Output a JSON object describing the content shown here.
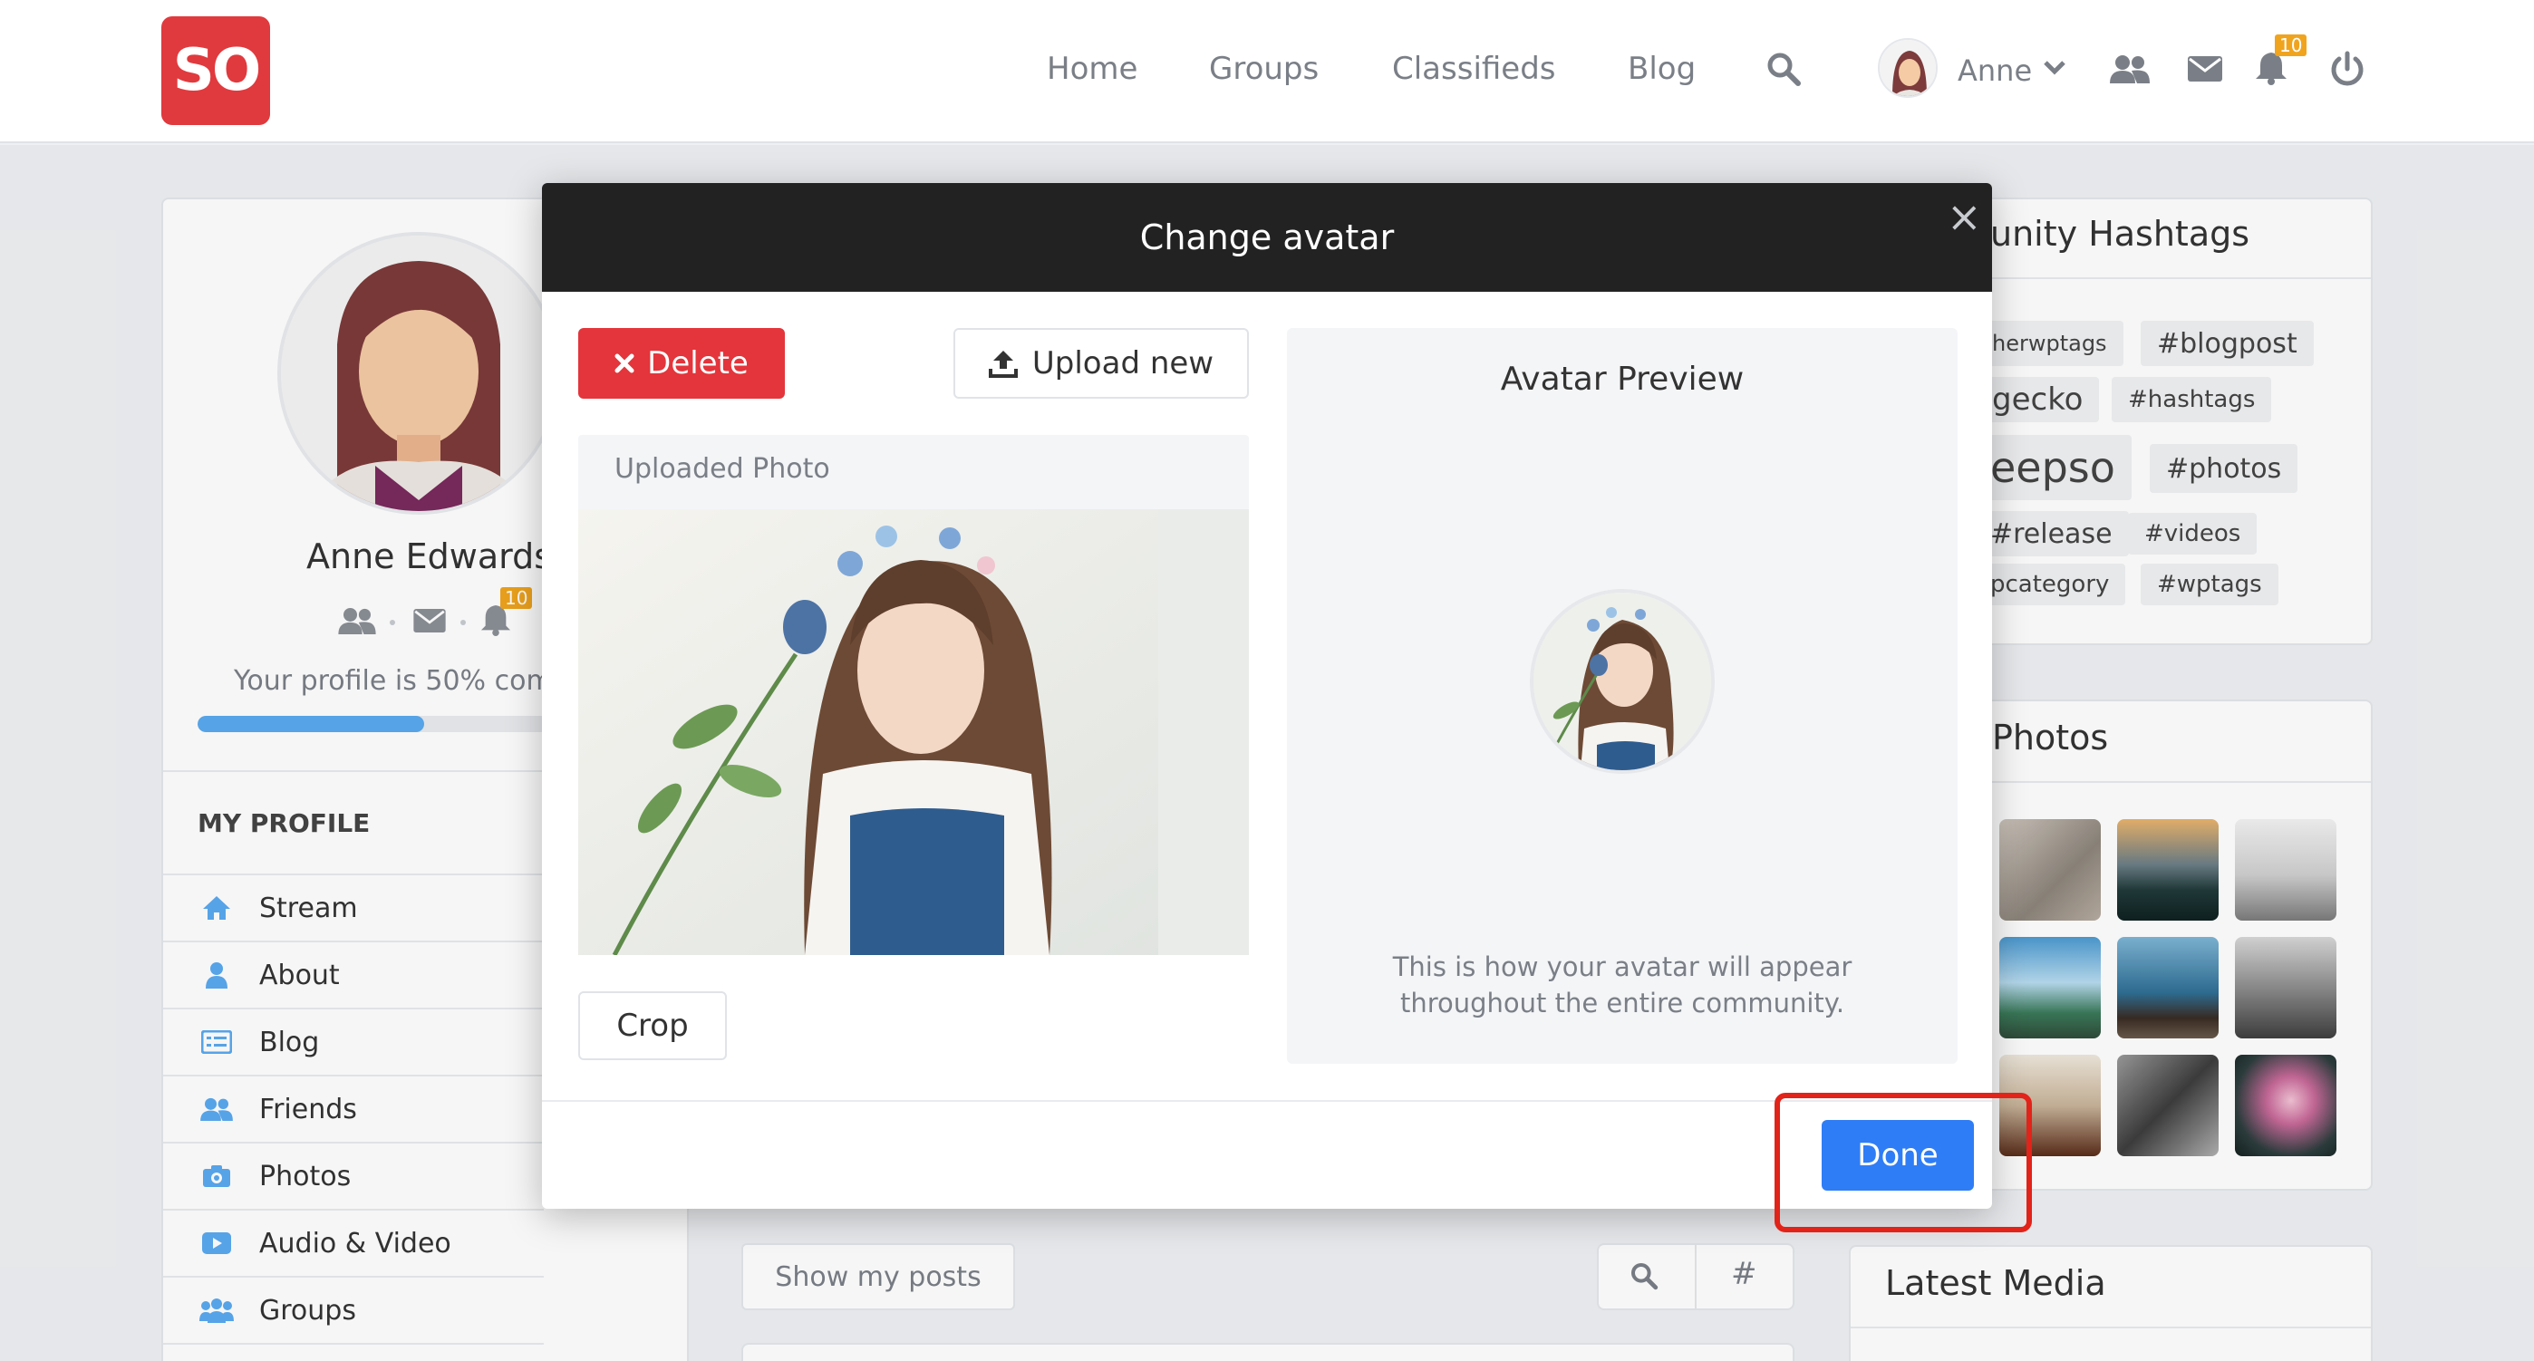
{
  "header": {
    "logo": "SO",
    "nav": [
      "Home",
      "Groups",
      "Classifieds",
      "Blog"
    ],
    "user_name": "Anne",
    "notification_count": "10"
  },
  "profile": {
    "name": "Anne Edwards",
    "notification_count": "10",
    "completion_text": "Your profile is 50% com",
    "completion_fraction": 0.5,
    "menu_title": "MY PROFILE",
    "menu": [
      "Stream",
      "About",
      "Blog",
      "Friends",
      "Photos",
      "Audio & Video",
      "Groups"
    ]
  },
  "feed": {
    "show_posts": "Show my posts",
    "hash_symbol": "#"
  },
  "hashtags": {
    "title": "unity Hashtags",
    "tags": [
      "herwptags",
      "#blogpost",
      "gecko",
      "#hashtags",
      "eepso",
      "#photos",
      "#release",
      "#videos",
      "pcategory",
      "#wptags"
    ]
  },
  "photos_widget": {
    "title": "Photos"
  },
  "latest_media": {
    "title": "Latest Media"
  },
  "modal": {
    "title": "Change avatar",
    "close_symbol": "×",
    "delete_label": "Delete",
    "upload_label": "Upload new",
    "uploaded_photo_label": "Uploaded Photo",
    "crop_label": "Crop",
    "preview_title": "Avatar Preview",
    "preview_note_1": "This is how your avatar will appear",
    "preview_note_2": "throughout the entire community.",
    "done_label": "Done"
  },
  "colors": {
    "brand": "#e03a3e",
    "primary_button": "#2f7df6",
    "delete_button": "#e3353b",
    "highlight": "#e2231a",
    "badge": "#f0a41e",
    "progress": "#5aa9f0"
  }
}
